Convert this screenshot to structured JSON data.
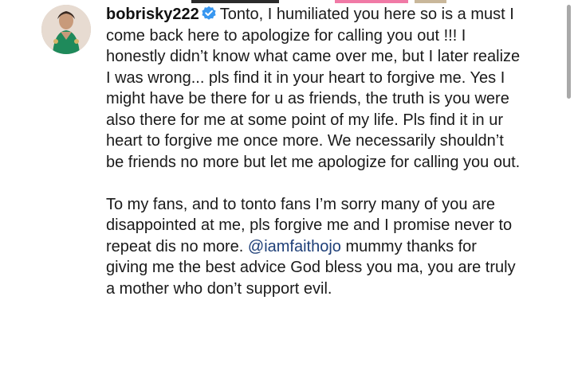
{
  "comment": {
    "username": "bobrisky222",
    "verified_icon": "verified-badge-icon",
    "text_part1": "Tonto, I humiliated you here so is a must I come back here to apologize for calling you out !!! I honestly didn’t know what came over me, but I later realize I was wrong... pls find it in your heart to forgive me. Yes I might have be there for u as friends, the truth is you were also there for me at some point of my life. Pls find it in ur heart to forgive me once more. We necessarily shouldn’t be friends no more but let me apologize for calling you out.",
    "text_part2": "To my fans, and to tonto fans I’m sorry many of you are disappointed at me, pls forgive me and I promise never to repeat dis no more.",
    "mention": "@iamfaithojo",
    "text_part3": " mummy thanks for giving me the best advice God bless you ma, you are truly a mother who don’t support evil."
  },
  "colors": {
    "mention": "#1e3f78",
    "verified": "#3897f0",
    "text": "#1a1a1a"
  }
}
